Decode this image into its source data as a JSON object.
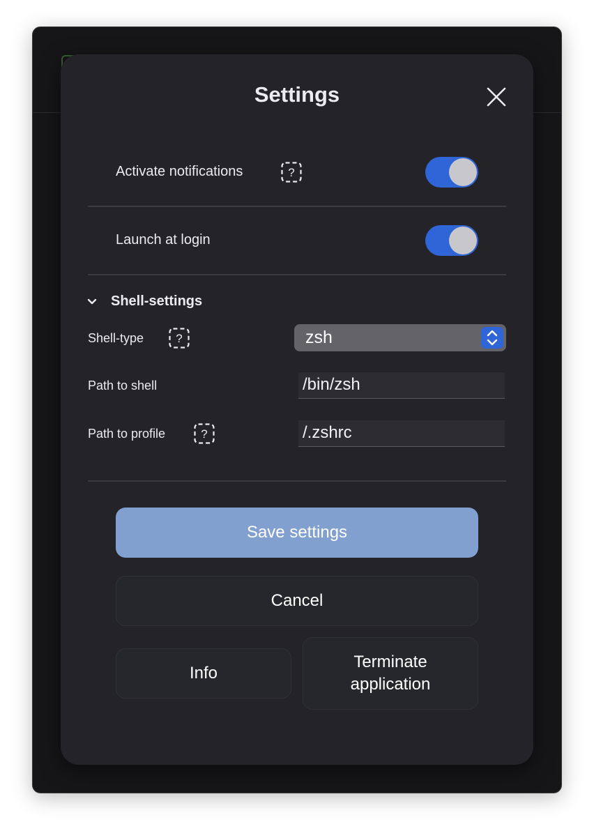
{
  "dialog": {
    "title": "Settings",
    "close_icon": "close-icon"
  },
  "notifications": {
    "label": "Activate notifications",
    "enabled": true
  },
  "launch": {
    "label": "Launch at login",
    "enabled": true
  },
  "shell": {
    "section_label": "Shell-settings",
    "expanded": true,
    "type_label": "Shell-type",
    "type_value": "zsh",
    "path_label": "Path to shell",
    "path_value": "/bin/zsh",
    "profile_label": "Path to profile",
    "profile_value": "/.zshrc"
  },
  "buttons": {
    "save": "Save settings",
    "cancel": "Cancel",
    "info": "Info",
    "terminate": "Terminate application"
  },
  "colors": {
    "accent": "#2f65d6",
    "save_button": "#819fcf",
    "modal_bg": "#232328"
  }
}
